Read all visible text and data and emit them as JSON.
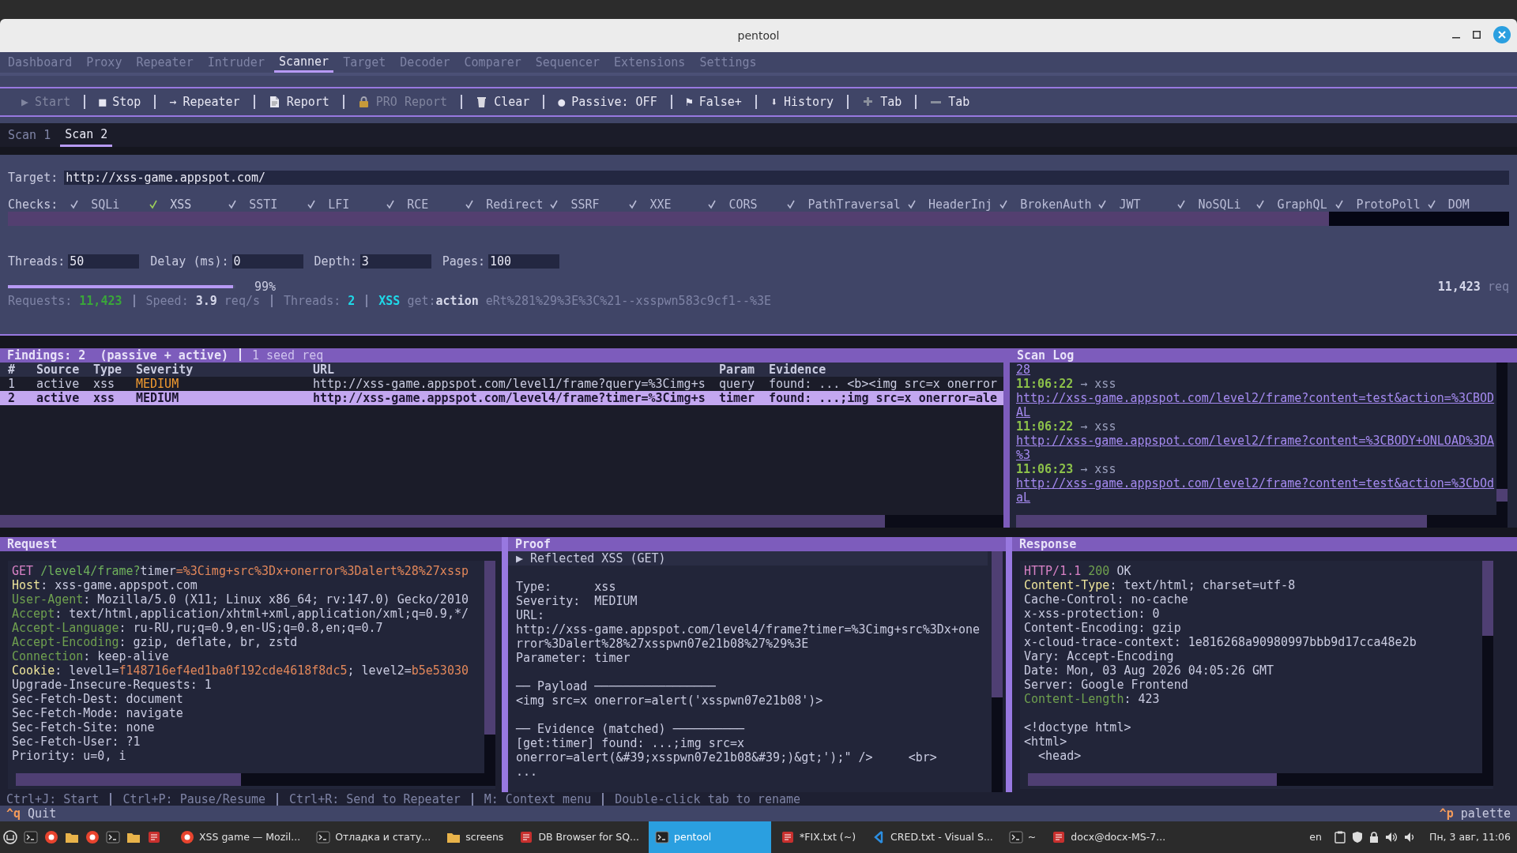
{
  "window": {
    "title": "pentool"
  },
  "tabs": [
    {
      "label": "Dashboard",
      "selected": false
    },
    {
      "label": "Proxy",
      "selected": false
    },
    {
      "label": "Repeater",
      "selected": false
    },
    {
      "label": "Intruder",
      "selected": false
    },
    {
      "label": "Scanner",
      "selected": true
    },
    {
      "label": "Target",
      "selected": false
    },
    {
      "label": "Decoder",
      "selected": false
    },
    {
      "label": "Comparer",
      "selected": false
    },
    {
      "label": "Sequencer",
      "selected": false
    },
    {
      "label": "Extensions",
      "selected": false
    },
    {
      "label": "Settings",
      "selected": false
    }
  ],
  "toolbar": [
    {
      "label": "Start",
      "glyph": "▶",
      "disabled": true
    },
    {
      "label": "Stop",
      "glyph": "■",
      "disabled": false
    },
    {
      "label": "Repeater",
      "glyph": "→",
      "disabled": false
    },
    {
      "label": "Report",
      "disabled": false
    },
    {
      "label": "PRO Report",
      "disabled": true
    },
    {
      "label": "Clear",
      "disabled": false
    },
    {
      "label": "Passive: OFF",
      "glyph": "●",
      "disabled": false
    },
    {
      "label": "False+",
      "glyph": "⚑",
      "disabled": false
    },
    {
      "label": "History",
      "glyph": "⬇",
      "disabled": false
    },
    {
      "label": "Tab",
      "disabled": false
    },
    {
      "label": "Tab",
      "disabled": false
    }
  ],
  "scan_tabs": [
    {
      "label": "Scan 1",
      "selected": false
    },
    {
      "label": "Scan 2",
      "selected": true
    }
  ],
  "target": {
    "label": "Target:",
    "value": "http://xss-game.appspot.com/"
  },
  "checks": {
    "label": "Checks:",
    "items": [
      {
        "label": "SQLi",
        "checked": true,
        "focused": false
      },
      {
        "label": "XSS",
        "checked": true,
        "focused": true
      },
      {
        "label": "SSTI",
        "checked": true,
        "focused": false
      },
      {
        "label": "LFI",
        "checked": true,
        "focused": false
      },
      {
        "label": "RCE",
        "checked": true,
        "focused": false
      },
      {
        "label": "Redirect",
        "checked": true,
        "focused": false
      },
      {
        "label": "SSRF",
        "checked": true,
        "focused": false
      },
      {
        "label": "XXE",
        "checked": true,
        "focused": false
      },
      {
        "label": "CORS",
        "checked": true,
        "focused": false
      },
      {
        "label": "PathTraversal",
        "checked": true,
        "focused": false
      },
      {
        "label": "HeaderInj",
        "checked": true,
        "focused": false
      },
      {
        "label": "BrokenAuth",
        "checked": true,
        "focused": false
      },
      {
        "label": "JWT",
        "checked": true,
        "focused": false
      },
      {
        "label": "NoSQLi",
        "checked": true,
        "focused": false
      },
      {
        "label": "GraphQL",
        "checked": true,
        "focused": false
      },
      {
        "label": "ProtoPoll",
        "checked": true,
        "focused": false
      },
      {
        "label": "DOM",
        "checked": true,
        "focused": false
      }
    ]
  },
  "fields": [
    {
      "label": "Threads:",
      "value": "50"
    },
    {
      "label": "Delay (ms):",
      "value": "0"
    },
    {
      "label": "Depth:",
      "value": "3"
    },
    {
      "label": "Pages:",
      "value": "100"
    }
  ],
  "progress": {
    "level": 0.99,
    "reading": "99%"
  },
  "total": [
    {
      "text": "11,423",
      "kind": "bold"
    },
    {
      "text": " req",
      "kind": "label"
    }
  ],
  "stats": [
    [
      {
        "text": "Requests: ",
        "kind": "label"
      },
      {
        "text": "11,423",
        "kind": "green"
      }
    ],
    [
      {
        "text": "Speed: ",
        "kind": "label"
      },
      {
        "text": "3.9",
        "kind": "bold"
      },
      {
        "text": " req/s",
        "kind": "label"
      }
    ],
    [
      {
        "text": "Threads: ",
        "kind": "label"
      },
      {
        "text": "2",
        "kind": "cyan"
      }
    ],
    [
      {
        "text": "XSS",
        "kind": "cyan"
      },
      {
        "text": " get:",
        "kind": "label"
      },
      {
        "text": "action",
        "kind": "bold"
      },
      {
        "text": "  eRt%281%29%3E%3C%21--xsspwn583c9cf1--%3E",
        "kind": "label"
      }
    ]
  ],
  "findings": {
    "title": "Findings: 2  (passive + active)",
    "note": "1 seed req",
    "columns": [
      "#",
      "Source",
      "Type",
      "Severity",
      "URL",
      "Param",
      "Evidence"
    ],
    "rows": [
      {
        "selected": false,
        "cells": [
          "1",
          "active",
          "xss",
          "MEDIUM",
          "http://xss-game.appspot.com/level1/frame?query=%3Cimg+s",
          "query",
          "found: ... <b><img src=x onerror"
        ]
      },
      {
        "selected": true,
        "cells": [
          "2",
          "active",
          "xss",
          "MEDIUM",
          "http://xss-game.appspot.com/level4/frame?timer=%3Cimg+s",
          "timer",
          "found: ...;img src=x onerror=ale"
        ]
      }
    ]
  },
  "scan_log": {
    "title": "Scan Log",
    "lines": [
      {
        "kind": "link",
        "text": "28"
      },
      {
        "kind": "entry",
        "time": "11:06:22",
        "text": "→ xss"
      },
      {
        "kind": "link",
        "text": "http://xss-game.appspot.com/level2/frame?content=test&action=%3CBOD"
      },
      {
        "kind": "link",
        "text": "AL"
      },
      {
        "kind": "entry",
        "time": "11:06:22",
        "text": "→ xss"
      },
      {
        "kind": "link",
        "text": "http://xss-game.appspot.com/level2/frame?content=%3CBODY+ONLOAD%3DA"
      },
      {
        "kind": "link",
        "text": "%3"
      },
      {
        "kind": "entry",
        "time": "11:06:23",
        "text": "→ xss"
      },
      {
        "kind": "link",
        "text": "http://xss-game.appspot.com/level2/frame?content=test&action=%3CbOd"
      },
      {
        "kind": "link",
        "text": "aL"
      }
    ]
  },
  "request": {
    "title": "Request",
    "lines": [
      [
        {
          "text": "GET ",
          "kind": "method"
        },
        {
          "text": "/level4/frame?",
          "kind": "path"
        },
        {
          "text": "timer",
          "kind": "plain"
        },
        {
          "text": "=%3Cimg+src%3Dx+onerror%3Dalert%28%27xssp",
          "kind": "val"
        }
      ],
      [
        {
          "text": "Host",
          "kind": "key"
        },
        {
          "text": ": xss-game.appspot.com",
          "kind": "plain"
        }
      ],
      [
        {
          "text": "User-Agent",
          "kind": "hdr"
        },
        {
          "text": ": Mozilla/5.0 (X11; Linux x86_64; rv:147.0) Gecko/2010",
          "kind": "plain"
        }
      ],
      [
        {
          "text": "Accept",
          "kind": "hdr"
        },
        {
          "text": ": text/html,application/xhtml+xml,application/xml;q=0.9,*/",
          "kind": "plain"
        }
      ],
      [
        {
          "text": "Accept-Language",
          "kind": "hdr"
        },
        {
          "text": ": ru-RU,ru;q=0.9,en-US;q=0.8,en;q=0.7",
          "kind": "plain"
        }
      ],
      [
        {
          "text": "Accept-Encoding",
          "kind": "hdr"
        },
        {
          "text": ": gzip, deflate, br, zstd",
          "kind": "plain"
        }
      ],
      [
        {
          "text": "Connection",
          "kind": "hdr"
        },
        {
          "text": ": keep-alive",
          "kind": "plain"
        }
      ],
      [
        {
          "text": "Cookie",
          "kind": "key"
        },
        {
          "text": ": level1=",
          "kind": "plain"
        },
        {
          "text": "f148716ef4ed1ba0f192cde4618f8dc5",
          "kind": "val"
        },
        {
          "text": "; level2=",
          "kind": "plain"
        },
        {
          "text": "b5e53030",
          "kind": "val"
        }
      ],
      [
        {
          "text": "Upgrade-Insecure-Requests: 1",
          "kind": "plain"
        }
      ],
      [
        {
          "text": "Sec-Fetch-Dest: document",
          "kind": "plain"
        }
      ],
      [
        {
          "text": "Sec-Fetch-Mode: navigate",
          "kind": "plain"
        }
      ],
      [
        {
          "text": "Sec-Fetch-Site: none",
          "kind": "plain"
        }
      ],
      [
        {
          "text": "Sec-Fetch-User: ?1",
          "kind": "plain"
        }
      ],
      [
        {
          "text": "Priority: u=0, i",
          "kind": "plain"
        }
      ]
    ]
  },
  "proof": {
    "title": "Proof",
    "heading": "▶ Reflected XSS (GET)",
    "blocks": [
      [
        "Type:      xss",
        "Severity:  MEDIUM",
        "URL:",
        "http://xss-game.appspot.com/level4/frame?timer=%3Cimg+src%3Dx+one",
        "rror%3Dalert%28%27xsspwn07e21b08%27%29%3E",
        "Parameter: timer"
      ],
      [
        "── Payload ─────────────────",
        "<img src=x onerror=alert('xsspwn07e21b08')>"
      ],
      [
        "── Evidence (matched) ──────────",
        "[get:timer] found: ...;img src=x",
        "onerror=alert(&#39;xsspwn07e21b08&#39;)&gt;');\" />     <br>",
        "..."
      ]
    ]
  },
  "response": {
    "title": "Response",
    "headers": [
      [
        {
          "text": "HTTP/1.1 ",
          "kind": "method"
        },
        {
          "text": "200",
          "kind": "hdr"
        },
        {
          "text": " OK",
          "kind": "plain"
        }
      ],
      [
        {
          "text": "Content-Type",
          "kind": "key"
        },
        {
          "text": ": text/html; charset=utf-8",
          "kind": "plain"
        }
      ],
      [
        {
          "text": "Cache-Control: no-cache",
          "kind": "plain"
        }
      ],
      [
        {
          "text": "x-xss-protection: 0",
          "kind": "plain"
        }
      ],
      [
        {
          "text": "Content-Encoding: gzip",
          "kind": "plain"
        }
      ],
      [
        {
          "text": "x-cloud-trace-context: 1e816268a90980997bbb9d17cca48e2b",
          "kind": "plain"
        }
      ],
      [
        {
          "text": "Vary: Accept-Encoding",
          "kind": "plain"
        }
      ],
      [
        {
          "text": "Date: Mon, 03 Aug 2026 04:05:26 GMT",
          "kind": "plain"
        }
      ],
      [
        {
          "text": "Server: Google Frontend",
          "kind": "plain"
        }
      ],
      [
        {
          "text": "Content-Length",
          "kind": "hdr"
        },
        {
          "text": ": 423",
          "kind": "plain"
        }
      ]
    ],
    "body": [
      "<!doctype html>",
      "<html>",
      "  <head>"
    ]
  },
  "hints": [
    "Ctrl+J: Start",
    "Ctrl+P: Pause/Resume",
    "Ctrl+R: Send to Repeater",
    "M: Context menu",
    "Double-click tab to rename"
  ],
  "status_bar": {
    "quit": {
      "key": "^q",
      "label": "Quit"
    },
    "palette": {
      "key": "^p",
      "label": "palette"
    }
  },
  "taskbar": {
    "windows": [
      {
        "label": "XSS game — Mozil...",
        "selected": false
      },
      {
        "label": "Отладка и стату...",
        "selected": false
      },
      {
        "label": "screens",
        "selected": false
      },
      {
        "label": "DB Browser for SQ...",
        "selected": false
      },
      {
        "label": "pentool",
        "selected": true
      },
      {
        "label": "*FIX.txt (~)",
        "selected": false
      },
      {
        "label": "CRED.txt - Visual S...",
        "selected": false
      },
      {
        "label": "~",
        "selected": false
      },
      {
        "label": "docx@docx-MS-7...",
        "selected": false
      }
    ],
    "layout": "en",
    "clock": "Пн, 3 авг, 11:06"
  }
}
